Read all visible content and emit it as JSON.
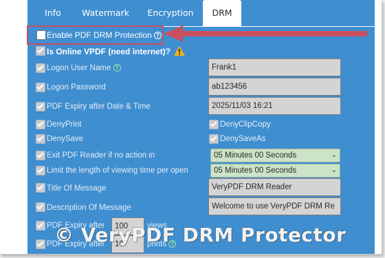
{
  "tabs": [
    {
      "label": "Info",
      "active": false
    },
    {
      "label": "Watermark",
      "active": false
    },
    {
      "label": "Encryption",
      "active": false
    },
    {
      "label": "DRM",
      "active": true
    }
  ],
  "enable_drm": {
    "label": "Enable PDF DRM Protection",
    "checked": false
  },
  "online": {
    "label": "Is Online VPDF (need internet)?"
  },
  "logon_user": {
    "label": "Logon User Name",
    "value": "Frank1"
  },
  "logon_password": {
    "label": "Logon Password",
    "value": "ab123456"
  },
  "expiry_date": {
    "label": "PDF Expiry after Date & Time",
    "value": "2025/11/03 16:21"
  },
  "deny_print": {
    "label": "DenyPrint"
  },
  "deny_clipcopy": {
    "label": "DenyClipCopy"
  },
  "deny_save": {
    "label": "DenySave"
  },
  "deny_saveas": {
    "label": "DenySaveAs"
  },
  "exit_reader": {
    "label": "Exit PDF Reader if no action in",
    "value": "05 Minutes 00 Seconds"
  },
  "limit_view": {
    "label": "Limit the length of viewing time per open",
    "value": "05 Minutes 00 Seconds"
  },
  "msg_title": {
    "label": "Title Of Message",
    "value": "VeryPDF DRM Reader"
  },
  "msg_desc": {
    "label": "Description Of Message",
    "value": "Welcome to use VeryPDF DRM Re"
  },
  "expiry_views": {
    "prefix": "PDF Expiry after",
    "value": "100",
    "suffix": "views"
  },
  "expiry_prints": {
    "prefix": "PDF Expiry after",
    "value": "10",
    "suffix": "prints"
  },
  "watermark": "© VeryPDF DRM Protector",
  "colors": {
    "panel": "#3f8ed0",
    "highlight": "#c9505f",
    "select_bg": "#cbe3c6",
    "field_bg": "#d4d4d4"
  },
  "icons": {
    "help": "question-circle-icon",
    "warning": "warning-triangle-icon",
    "arrow": "left-arrow-annotation"
  }
}
